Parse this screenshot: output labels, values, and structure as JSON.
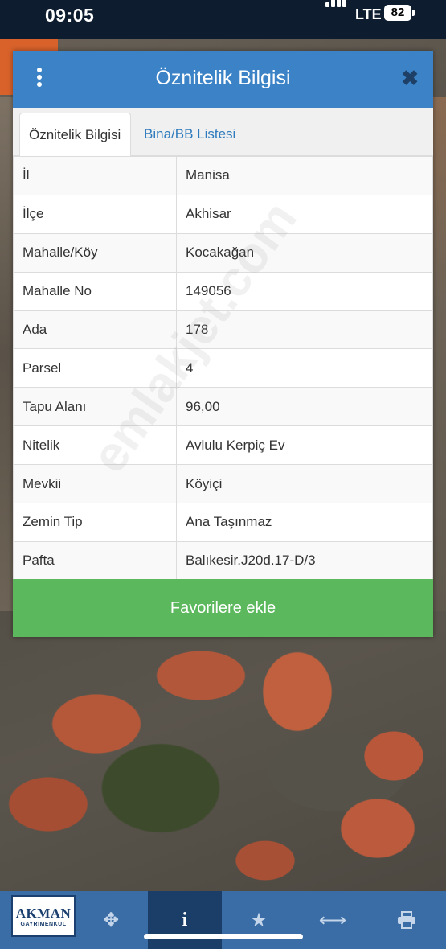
{
  "status_bar": {
    "time": "09:05",
    "network": "LTE",
    "battery": "82"
  },
  "dialog": {
    "title": "Öznitelik Bilgisi",
    "close_icon": "close-icon",
    "menu_icon": "kebab-menu-icon",
    "tabs": [
      {
        "label": "Öznitelik Bilgisi",
        "active": true
      },
      {
        "label": "Bina/BB Listesi",
        "active": false
      }
    ],
    "rows": [
      {
        "key": "İl",
        "value": "Manisa"
      },
      {
        "key": "İlçe",
        "value": "Akhisar"
      },
      {
        "key": "Mahalle/Köy",
        "value": "Kocakağan"
      },
      {
        "key": "Mahalle No",
        "value": "149056"
      },
      {
        "key": "Ada",
        "value": "178"
      },
      {
        "key": "Parsel",
        "value": "4"
      },
      {
        "key": "Tapu Alanı",
        "value": "96,00"
      },
      {
        "key": "Nitelik",
        "value": "Avlulu Kerpiç Ev"
      },
      {
        "key": "Mevkii",
        "value": "Köyiçi"
      },
      {
        "key": "Zemin Tip",
        "value": "Ana Taşınmaz"
      },
      {
        "key": "Pafta",
        "value": "Balıkesir.J20d.17-D/3"
      }
    ],
    "favorite_button": "Favorilere ekle"
  },
  "watermark": "emlakjet.com",
  "logo": {
    "main": "AKMAN",
    "sub": "GAYRIMENKUL"
  },
  "toolbar": {
    "items": [
      {
        "icon": "refresh-icon",
        "active": false
      },
      {
        "icon": "locate-crosshair-icon",
        "active": false
      },
      {
        "icon": "info-icon",
        "active": true
      },
      {
        "icon": "star-icon",
        "active": false
      },
      {
        "icon": "measure-arrows-icon",
        "active": false
      },
      {
        "icon": "print-icon",
        "active": false
      }
    ]
  },
  "colors": {
    "header_blue": "#3b83c6",
    "tab_link": "#2f7bbd",
    "favorite_green": "#5cb85c",
    "toolbar_blue": "#3a6da6",
    "toolbar_active": "#1a3e68",
    "status_bar": "#0d1c2e"
  }
}
